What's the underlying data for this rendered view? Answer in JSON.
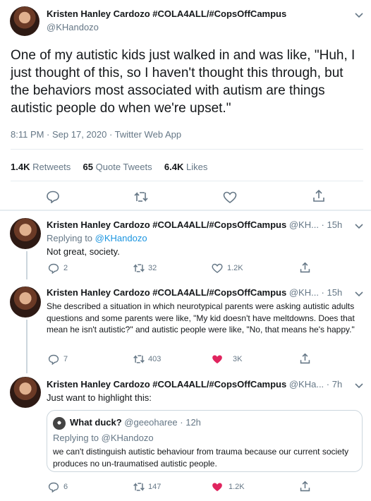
{
  "main_tweet": {
    "name": "Kristen Hanley Cardozo #COLA4ALL/#CopsOffCampus",
    "handle": "@KHandozo",
    "text": "One of my autistic kids just walked in and was like, \"Huh, I just thought of this, so I haven't thought this through, but the behaviors most associated with autism are things autistic people do when we're upset.\"",
    "timestamp": "8:11 PM · Sep 17, 2020 · Twitter Web App",
    "retweets_count": "1.4K",
    "retweets_label": "Retweets",
    "quotes_count": "65",
    "quotes_label": "Quote Tweets",
    "likes_count": "6.4K",
    "likes_label": "Likes"
  },
  "replies": [
    {
      "name": "Kristen Hanley Cardozo #COLA4ALL/#CopsOffCampus",
      "handle_time": "@KH... · 15h",
      "replying_prefix": "Replying to",
      "replying_to": "@KHandozo",
      "text": "Not great, society.",
      "reply_count": "2",
      "retweet_count": "32",
      "like_count": "1.2K"
    },
    {
      "name": "Kristen Hanley Cardozo #COLA4ALL/#CopsOffCampus",
      "handle_time": "@KH... · 15h",
      "text": "She described a situation in which neurotypical parents were asking autistic adults questions and some parents were like, \"My kid doesn't have meltdowns. Does that mean he isn't autistic?\" and autistic people were like, \"No, that means he's happy.\"",
      "reply_count": "7",
      "retweet_count": "403",
      "like_count": "3K"
    },
    {
      "name": "Kristen Hanley Cardozo #COLA4ALL/#CopsOffCampus",
      "handle_time": "@KHa... · 7h",
      "text": "Just want to highlight this:",
      "reply_count": "6",
      "retweet_count": "147",
      "like_count": "1.2K",
      "quoted": {
        "name": "What duck?",
        "handle_time": "@geeoharee · 12h",
        "replying_prefix": "Replying to",
        "replying_to": "@KHandozo",
        "text": "we can't distinguish autistic behaviour from trauma because our current society produces no un-traumatised autistic people."
      }
    }
  ],
  "colors": {
    "text": "#14171a",
    "secondary": "#657786",
    "link": "#1b95e0",
    "like_active": "#e0245e",
    "border": "#e6ecf0"
  }
}
